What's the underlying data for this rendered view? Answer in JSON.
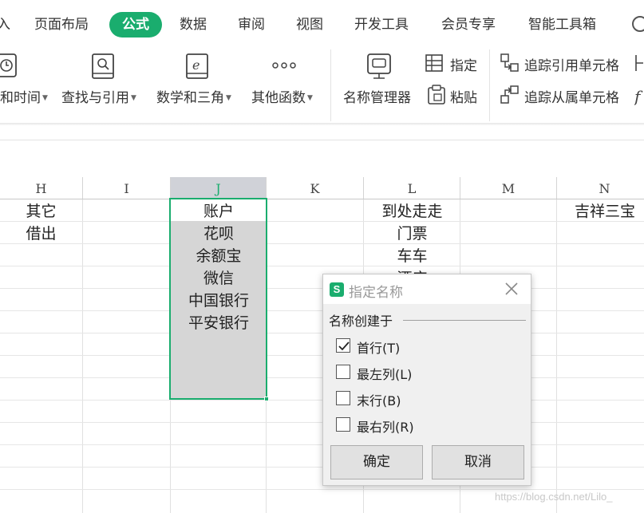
{
  "menu": {
    "tabs": [
      "页面布局",
      "公式",
      "数据",
      "审阅",
      "视图",
      "开发工具",
      "会员专享",
      "智能工具箱"
    ],
    "active_tab": "公式",
    "left_fragment": "入"
  },
  "ribbon": {
    "datetime": "和时间",
    "lookup": "查找与引用",
    "math": "数学和三角",
    "other": "其他函数",
    "name_manager": "名称管理器",
    "assign": "指定",
    "paste": "粘贴",
    "trace_precedents": "追踪引用单元格",
    "trace_dependents": "追踪从属单元格"
  },
  "grid": {
    "columns": [
      "H",
      "I",
      "J",
      "K",
      "L",
      "M",
      "N"
    ],
    "selected_column": "J",
    "col_h": [
      "其它",
      "借出"
    ],
    "col_j": [
      "账户",
      "花呗",
      "余额宝",
      "微信",
      "中国银行",
      "平安银行"
    ],
    "col_l": [
      "到处走走",
      "门票",
      "车车",
      "酒店"
    ],
    "col_n": [
      "吉祥三宝"
    ]
  },
  "dialog": {
    "title": "指定名称",
    "group_label": "名称创建于",
    "options": [
      {
        "label": "首行(T)",
        "checked": true
      },
      {
        "label": "最左列(L)",
        "checked": false
      },
      {
        "label": "末行(B)",
        "checked": false
      },
      {
        "label": "最右列(R)",
        "checked": false
      }
    ],
    "ok": "确定",
    "cancel": "取消"
  },
  "watermark": "https://blog.csdn.net/Lilo_",
  "colors": {
    "accent": "#1aad6e",
    "selection_fill": "#d6d6d6",
    "header_selected": "#d0d2d8"
  }
}
